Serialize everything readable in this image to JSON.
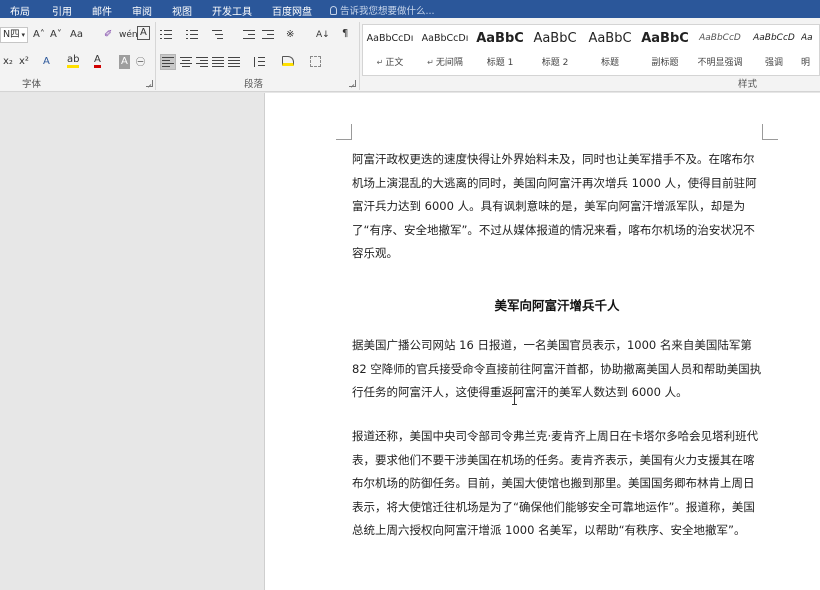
{
  "tabs": [
    "布局",
    "引用",
    "邮件",
    "审阅",
    "视图",
    "开发工具",
    "百度网盘"
  ],
  "tell_me": "告诉我您想要做什么...",
  "ribbon": {
    "font_size_value": "N四",
    "grow_font": "A˄",
    "shrink_font": "A˅",
    "change_case": "Aa",
    "clear_format": "✐",
    "phonetic": "wén",
    "char_border": "A",
    "subscript": "x₂",
    "superscript": "x²",
    "text_effect": "A",
    "highlight": "ab",
    "font_color": "A",
    "char_shading": "A",
    "enclose": "㊀",
    "font_group_label": "字体",
    "paragraph_group_label": "段落",
    "styles_group_label": "样式",
    "sort_icon": "A↓",
    "para_mark_icon": "¶",
    "chinese_layout": "※",
    "launcher_symbol": "⌟"
  },
  "styles": [
    {
      "sample": "AaBbCcDı",
      "name": "正文",
      "para": true
    },
    {
      "sample": "AaBbCcDı",
      "name": "无间隔",
      "para": true
    },
    {
      "sample": "AaBbC",
      "name": "标题 1",
      "para": false
    },
    {
      "sample": "AaBbC",
      "name": "标题 2",
      "para": false
    },
    {
      "sample": "AaBbC",
      "name": "标题",
      "para": false
    },
    {
      "sample": "AaBbC",
      "name": "副标题",
      "para": false
    },
    {
      "sample": "AaBbCcD",
      "name": "不明显强调",
      "para": false
    },
    {
      "sample": "AaBbCcD",
      "name": "强调",
      "para": false
    },
    {
      "sample": "Aa",
      "name": "明",
      "para": false
    }
  ],
  "document": {
    "p1": "阿富汗政权更迭的速度快得让外界始料未及，同时也让美军措手不及。在喀布尔机场上演混乱的大逃离的同时，美国向阿富汗再次增兵 1000 人，使得目前驻阿富汗兵力达到 6000 人。具有讽刺意味的是，美军向阿富汗增派军队，却是为了“有序、安全地撤军”。不过从媒体报道的情况来看，喀布尔机场的治安状况不容乐观。",
    "heading": "美军向阿富汗增兵千人",
    "p2": "据美国广播公司网站 16 日报道，一名美国官员表示，1000 名来自美国陆军第 82 空降师的官兵接受命令直接前往阿富汗首都，协助撤离美国人员和帮助美国执行任务的阿富汗人，这使得重返阿富汗的美军人数达到 6000 人。",
    "p3": "报道还称，美国中央司令部司令弗兰克·麦肯齐上周日在卡塔尔多哈会见塔利班代表，要求他们不要干涉美国在机场的任务。麦肯齐表示，美国有火力支援其在喀布尔机场的防御任务。目前，美国大使馆也搬到那里。美国国务卿布林肯上周日表示，将大使馆迁往机场是为了“确保他们能够安全可靠地运作”。报道称，美国总统上周六授权向阿富汗增派 1000 名美军，以帮助“有秩序、安全地撤军”。"
  }
}
